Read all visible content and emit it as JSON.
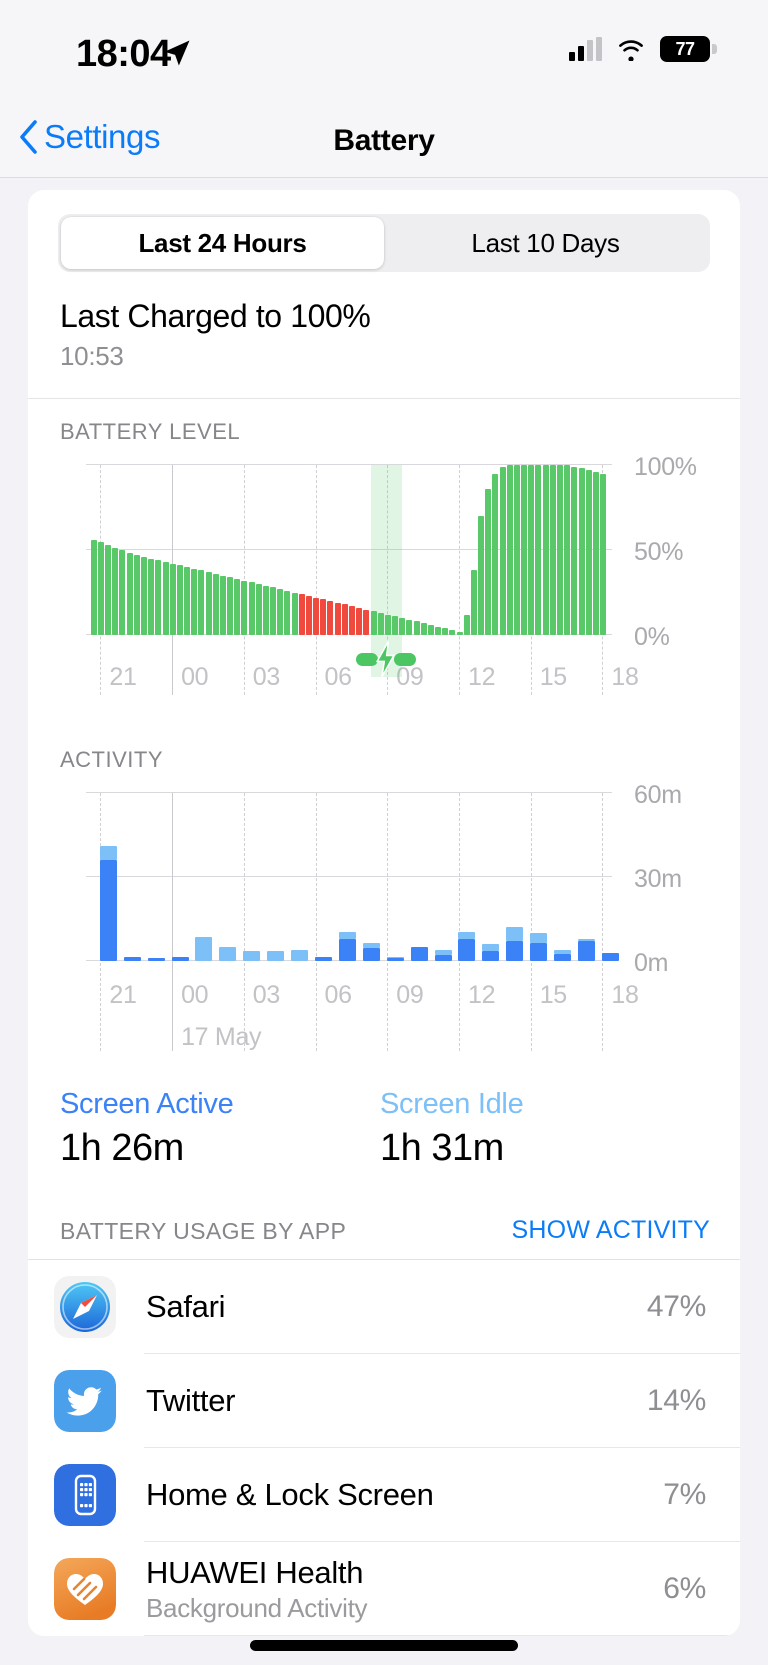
{
  "status_bar": {
    "time": "18:04",
    "battery_percent": "77",
    "icons": [
      "location-arrow-icon",
      "cellular-signal-icon",
      "wifi-icon",
      "battery-icon"
    ]
  },
  "nav": {
    "back_label": "Settings",
    "title": "Battery"
  },
  "segmented": {
    "options": [
      "Last 24 Hours",
      "Last 10 Days"
    ],
    "selected": "Last 24 Hours"
  },
  "last_charged": {
    "title": "Last Charged to 100%",
    "time": "10:53"
  },
  "screen_time": {
    "active_label": "Screen Active",
    "active_value": "1h 26m",
    "idle_label": "Screen Idle",
    "idle_value": "1h 31m"
  },
  "usage": {
    "section_title": "BATTERY USAGE BY APP",
    "action_label": "SHOW ACTIVITY",
    "apps": [
      {
        "name": "Safari",
        "subtitle": "",
        "percent": "47%",
        "icon": "safari-icon"
      },
      {
        "name": "Twitter",
        "subtitle": "",
        "percent": "14%",
        "icon": "twitter-icon"
      },
      {
        "name": "Home & Lock Screen",
        "subtitle": "",
        "percent": "7%",
        "icon": "home-lock-screen-icon"
      },
      {
        "name": "HUAWEI Health",
        "subtitle": "Background Activity",
        "percent": "6%",
        "icon": "huawei-health-icon"
      }
    ]
  },
  "colors": {
    "accent_blue": "#0b7cf8",
    "battery_green": "#58c869",
    "low_power_red": "#f0493e",
    "screen_active_blue": "#3b82f6",
    "screen_idle_blue": "#7cc0f7"
  },
  "chart_data": [
    {
      "type": "bar",
      "title": "BATTERY LEVEL",
      "ylabel": "",
      "xlabel": "",
      "ylim": [
        0,
        100
      ],
      "yticks": [
        "0%",
        "50%",
        "100%"
      ],
      "ytick_values": [
        0,
        50,
        100
      ],
      "xticks": [
        "21",
        "00",
        "03",
        "06",
        "09",
        "12",
        "15",
        "18"
      ],
      "xtick_hours": [
        21,
        0,
        3,
        6,
        9,
        12,
        15,
        18
      ],
      "grid": true,
      "legend": "none",
      "day_boundary_tick": "00",
      "charging_annotation": {
        "icon": "charging-bolt-icon",
        "start_hour": 8.3,
        "end_hour": 9.6
      },
      "series": [
        {
          "name": "Battery level",
          "color": "#58c869"
        },
        {
          "name": "Low Power Mode",
          "color": "#f0493e"
        }
      ],
      "x": [
        20.6,
        20.9,
        21.2,
        21.5,
        21.8,
        22.1,
        22.4,
        22.7,
        23.0,
        23.3,
        23.6,
        23.9,
        0.2,
        0.5,
        0.8,
        1.1,
        1.4,
        1.7,
        2.0,
        2.3,
        2.6,
        2.9,
        3.2,
        3.5,
        3.8,
        4.1,
        4.4,
        4.7,
        5.0,
        5.3,
        5.6,
        5.9,
        6.2,
        6.5,
        6.8,
        7.1,
        7.4,
        7.7,
        8.0,
        8.3,
        8.6,
        8.9,
        9.2,
        9.5,
        9.8,
        10.1,
        10.4,
        10.7,
        11.0,
        11.3,
        11.6,
        11.9,
        12.2,
        12.5,
        12.8,
        13.1,
        13.4,
        13.7,
        14.0,
        14.3,
        14.6,
        14.9,
        15.2,
        15.5,
        15.8,
        16.1,
        16.4,
        16.7,
        17.0,
        17.3,
        17.6,
        17.9
      ],
      "values": [
        56,
        55,
        53,
        51,
        50,
        48,
        47,
        46,
        45,
        44,
        43,
        42,
        41,
        40,
        39,
        38,
        37,
        36,
        35,
        34,
        33,
        32,
        31,
        30,
        29,
        28,
        27,
        26,
        25,
        24,
        23,
        22,
        21,
        20,
        19,
        18,
        17,
        16,
        15,
        14,
        13,
        12,
        11,
        10,
        9,
        8,
        7,
        6,
        5,
        4,
        3,
        2,
        12,
        38,
        70,
        86,
        95,
        99,
        100,
        100,
        100,
        100,
        100,
        100,
        100,
        100,
        100,
        99,
        98,
        97,
        96,
        95,
        94
      ],
      "bar_colors_note": "green for normal, red for low-power segment between ~05:30 and 08:20, green again after charge",
      "low_power_range_hours": [
        5.3,
        8.2
      ],
      "description": "Battery drains from 56% at 21:00 to ~2% by 08:20 (red = Low Power Mode), charges to 100% by ~09:30, then slowly drains to ~77% at 18:00"
    },
    {
      "type": "bar",
      "title": "ACTIVITY",
      "stacked": true,
      "ylim": [
        0,
        60
      ],
      "yticks": [
        "0m",
        "30m",
        "60m"
      ],
      "ytick_values": [
        0,
        30,
        60
      ],
      "xticks": [
        "21",
        "00",
        "03",
        "06",
        "09",
        "12",
        "15",
        "18"
      ],
      "xtick_hours": [
        21,
        0,
        3,
        6,
        9,
        12,
        15,
        18
      ],
      "day_label": "17 May",
      "grid": true,
      "unit": "m",
      "categories": [
        "21",
        "22",
        "23",
        "00",
        "01",
        "02",
        "03",
        "04",
        "05",
        "06",
        "07",
        "08",
        "09",
        "10",
        "11",
        "12",
        "13",
        "14",
        "15",
        "16",
        "17",
        "18"
      ],
      "series": [
        {
          "name": "Screen Active",
          "color": "#3b82f6",
          "values": [
            36,
            1.5,
            1,
            1.5,
            0,
            0,
            0,
            0,
            0,
            1.5,
            8,
            4.5,
            1,
            5,
            2,
            8,
            3.5,
            7,
            6.5,
            2.5,
            7,
            3
          ]
        },
        {
          "name": "Screen Idle",
          "color": "#7cc0f7",
          "values": [
            5,
            0,
            0,
            0,
            8.5,
            5,
            3.5,
            3.5,
            4,
            0,
            2.5,
            2,
            0.5,
            0,
            2,
            2.5,
            2.5,
            5,
            3.5,
            1.5,
            1,
            0
          ]
        }
      ]
    }
  ]
}
